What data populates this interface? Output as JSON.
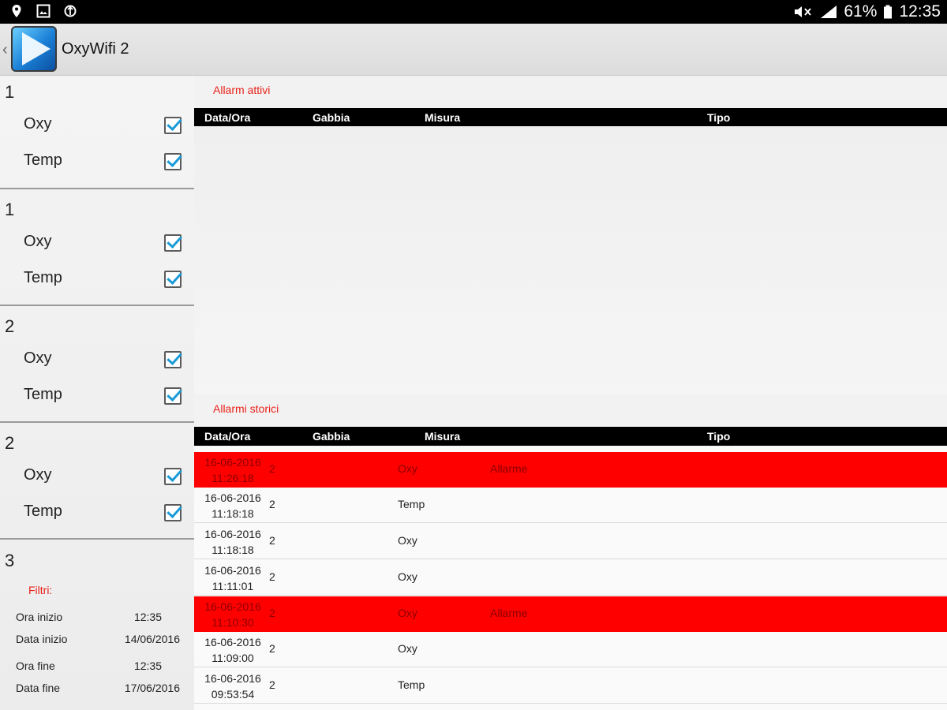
{
  "status_bar": {
    "battery": "61%",
    "time": "12:35",
    "icons": [
      "location-icon",
      "image-icon",
      "usb-icon",
      "mute-icon",
      "signal-icon",
      "battery-icon"
    ]
  },
  "app_bar": {
    "title": "OxyWifi 2",
    "icon": "play-logo-icon"
  },
  "sidebar": {
    "groups": [
      {
        "number": "1",
        "items": [
          {
            "label": "Oxy",
            "checked": true
          },
          {
            "label": "Temp",
            "checked": true
          }
        ]
      },
      {
        "number": "1",
        "items": [
          {
            "label": "Oxy",
            "checked": true
          },
          {
            "label": "Temp",
            "checked": true
          }
        ]
      },
      {
        "number": "2",
        "items": [
          {
            "label": "Oxy",
            "checked": true
          },
          {
            "label": "Temp",
            "checked": true
          }
        ]
      },
      {
        "number": "2",
        "items": [
          {
            "label": "Oxy",
            "checked": true
          },
          {
            "label": "Temp",
            "checked": true
          }
        ]
      }
    ],
    "group_3_number": "3",
    "filters": {
      "title": "Filtri:",
      "start_time_label": "Ora inizio",
      "start_time_value": "12:35",
      "start_date_label": "Data inizio",
      "start_date_value": "14/06/2016",
      "end_time_label": "Ora fine",
      "end_time_value": "12:35",
      "end_date_label": "Data fine",
      "end_date_value": "17/06/2016"
    }
  },
  "active_alarms": {
    "title": "Allarm attivi",
    "columns": [
      "Data/Ora",
      "Gabbia",
      "Misura",
      "Tipo"
    ]
  },
  "history_alarms": {
    "title": "Allarmi storici",
    "columns": [
      "Data/Ora",
      "Gabbia",
      "Misura",
      "Tipo"
    ],
    "rows": [
      {
        "date": "16-06-2016",
        "time": "11:26:18",
        "gabbia": "2",
        "misura": "Oxy",
        "tipo": "Allarme",
        "alarm": true
      },
      {
        "date": "16-06-2016",
        "time": "11:18:18",
        "gabbia": "2",
        "misura": "Temp",
        "tipo": "",
        "alarm": false
      },
      {
        "date": "16-06-2016",
        "time": "11:18:18",
        "gabbia": "2",
        "misura": "Oxy",
        "tipo": "",
        "alarm": false
      },
      {
        "date": "16-06-2016",
        "time": "11:11:01",
        "gabbia": "2",
        "misura": "Oxy",
        "tipo": "",
        "alarm": false
      },
      {
        "date": "16-06-2016",
        "time": "11:10:30",
        "gabbia": "2",
        "misura": "Oxy",
        "tipo": "Allarme",
        "alarm": true
      },
      {
        "date": "16-06-2016",
        "time": "11:09:00",
        "gabbia": "2",
        "misura": "Oxy",
        "tipo": "",
        "alarm": false
      },
      {
        "date": "16-06-2016",
        "time": "09:53:54",
        "gabbia": "2",
        "misura": "Temp",
        "tipo": "",
        "alarm": false
      }
    ]
  }
}
